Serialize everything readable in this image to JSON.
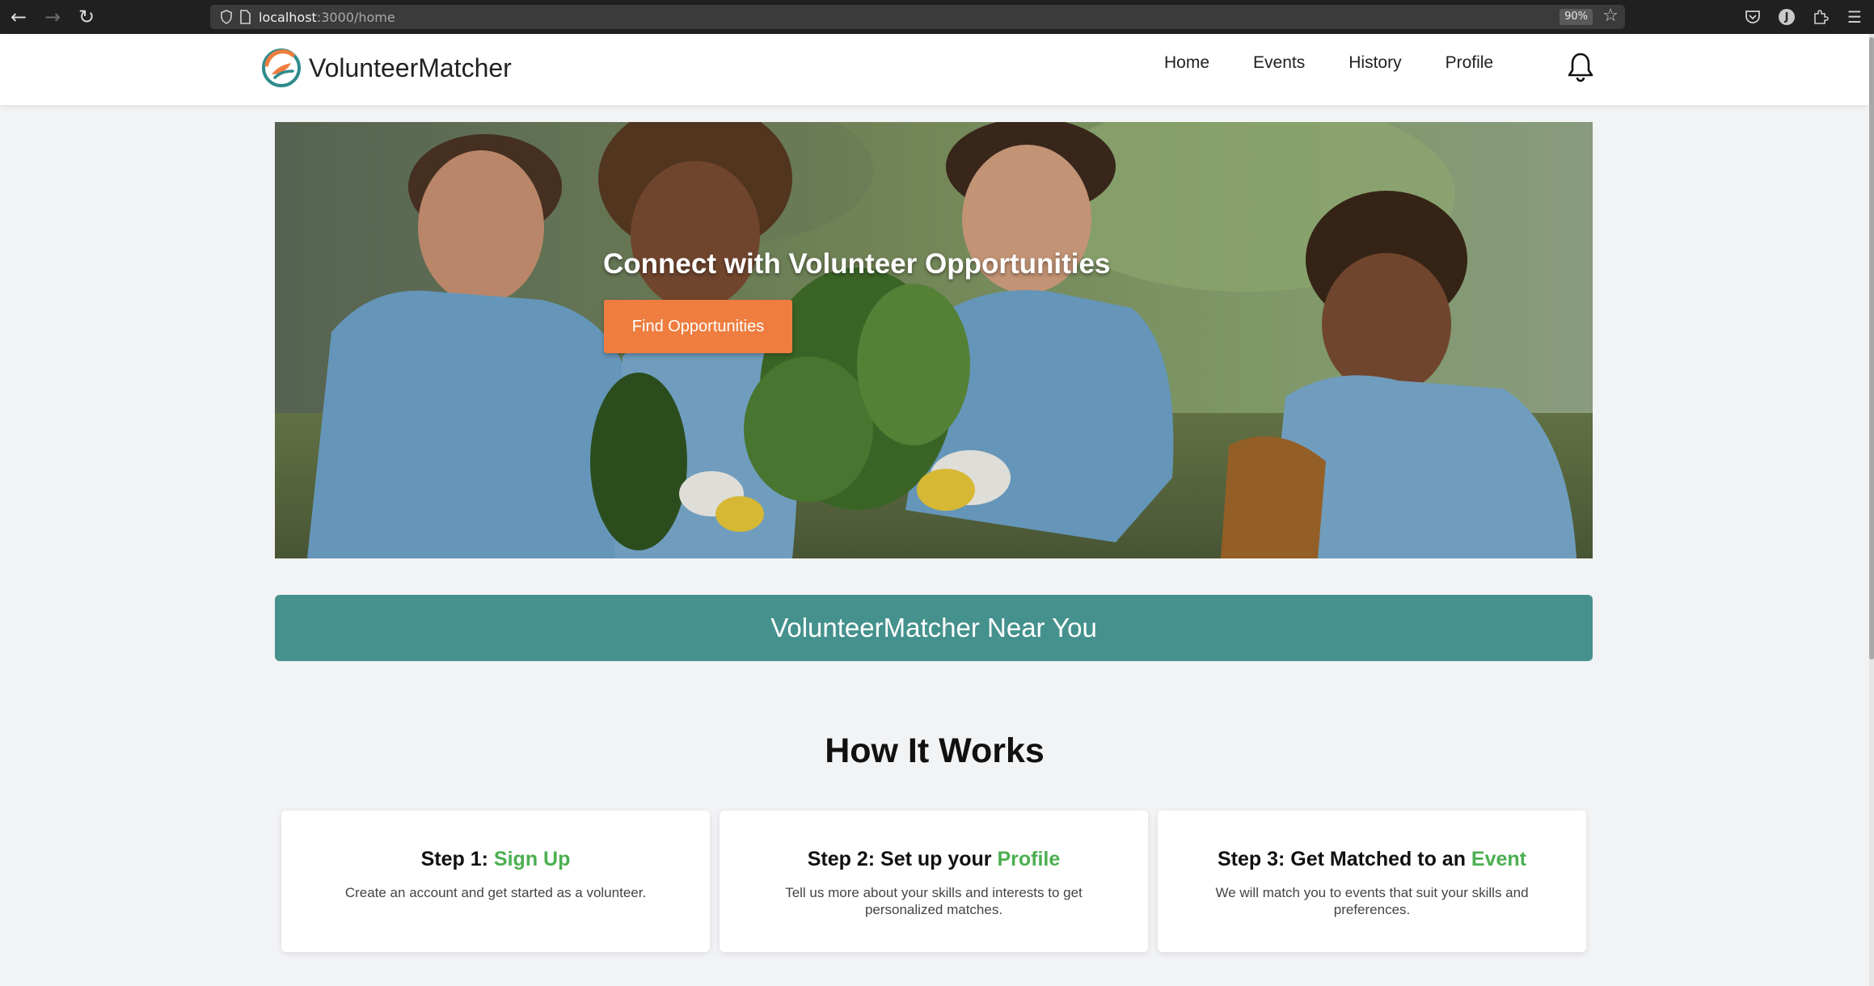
{
  "browser": {
    "url_host": "localhost",
    "url_path": ":3000/home",
    "zoom": "90%",
    "avatar_letter": "J"
  },
  "site": {
    "brand": "VolunteerMatcher",
    "nav": [
      "Home",
      "Events",
      "History",
      "Profile"
    ]
  },
  "hero": {
    "title": "Connect with Volunteer Opportunities",
    "cta_label": "Find Opportunities"
  },
  "banner": {
    "text": "VolunteerMatcher Near You"
  },
  "how": {
    "title": "How It Works",
    "steps": [
      {
        "prefix": "Step 1: ",
        "highlight": "Sign Up",
        "description": "Create an account and get started as a volunteer."
      },
      {
        "prefix": "Step 2: Set up your ",
        "highlight": "Profile",
        "description": "Tell us more about your skills and interests to get personalized matches."
      },
      {
        "prefix": "Step 3: Get Matched to an ",
        "highlight": "Event",
        "description": "We will match you to events that suit your skills and preferences."
      }
    ]
  },
  "colors": {
    "accent_orange": "#ee7d3f",
    "teal": "#44918d",
    "highlight_green": "#4caf50"
  },
  "icons": [
    "back-icon",
    "forward-icon",
    "reload-icon",
    "shield-icon",
    "page-icon",
    "star-icon",
    "pocket-icon",
    "extensions-icon",
    "menu-icon",
    "bell-icon"
  ]
}
